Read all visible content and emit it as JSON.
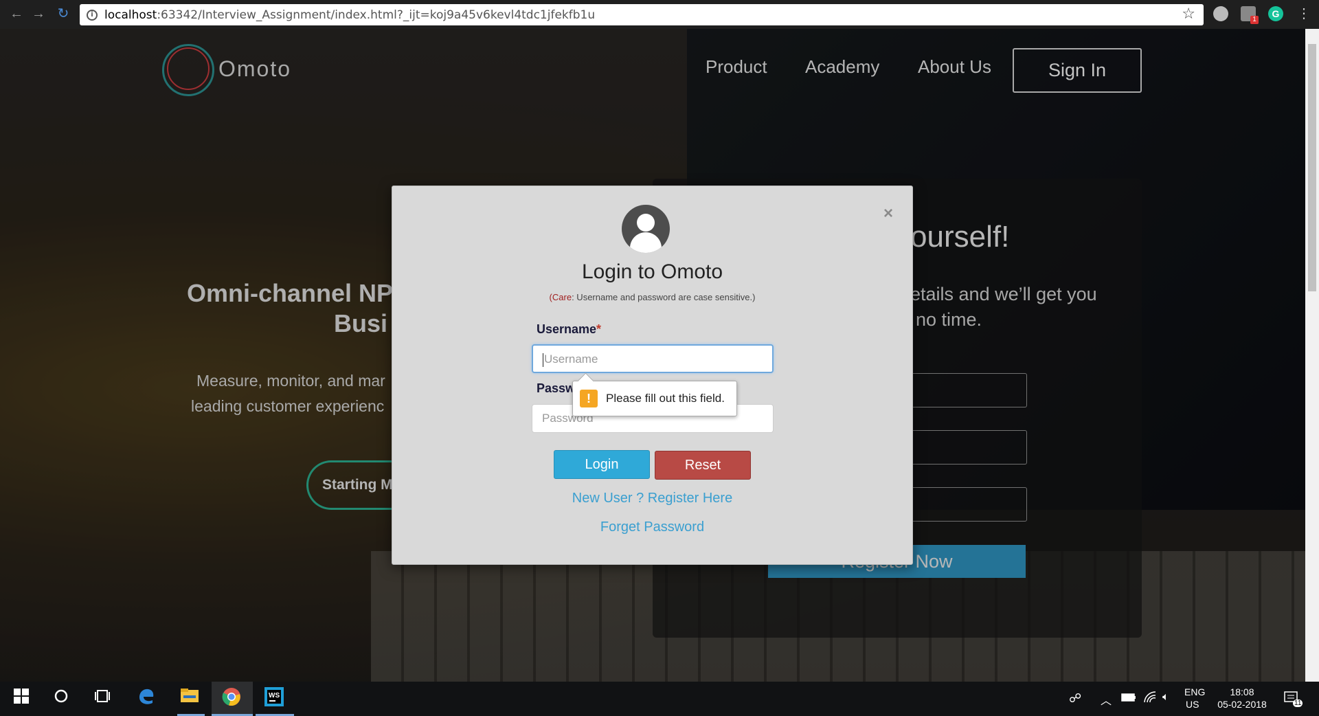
{
  "browser": {
    "url_host": "localhost",
    "url_rest": ":63342/Interview_Assignment/index.html?_ijt=koj9a45v6kevl4tdc1jfekfb1u",
    "back_icon": "←",
    "forward_icon": "→",
    "reload_icon": "↻",
    "info_icon": "i",
    "star_icon": "☆",
    "menu_icon": "⋮",
    "ext_badge": "1",
    "ext_g": "G"
  },
  "site": {
    "brand": "Omoto",
    "nav": [
      "Product",
      "Academy",
      "About Us"
    ],
    "signin": "Sign In",
    "hero_title_line1": "Omni-channel NP",
    "hero_title_line2": "Busi",
    "hero_text_line1": "Measure, monitor, and mar",
    "hero_text_line2": "leading customer experienc",
    "start_button": "Starting M",
    "register_heading": "ourself!",
    "register_text_line1": "etails and we’ll get you",
    "register_text_line2": "no time.",
    "register_button": "Register Now"
  },
  "modal": {
    "close_icon": "×",
    "title": "Login to Omoto",
    "note_care": "Care",
    "note_text": ": Username and password are case sensitive.)",
    "note_open": "(",
    "username_label": "Username",
    "required_mark": "*",
    "username_placeholder": "Username",
    "password_label": "Passw",
    "password_placeholder": "Password",
    "tooltip_icon": "!",
    "tooltip_text": "Please fill out this field.",
    "login_button": "Login",
    "reset_button": "Reset",
    "register_link": "New User ? Register Here",
    "forget_link": "Forget Password"
  },
  "taskbar": {
    "lang": "ENG",
    "region": "US",
    "time": "18:08",
    "date": "05-02-2018",
    "notifications": "11"
  },
  "colors": {
    "login": "#2fa9d8",
    "reset": "#b84a45",
    "link": "#3a9fd0",
    "warning": "#f5a623"
  }
}
